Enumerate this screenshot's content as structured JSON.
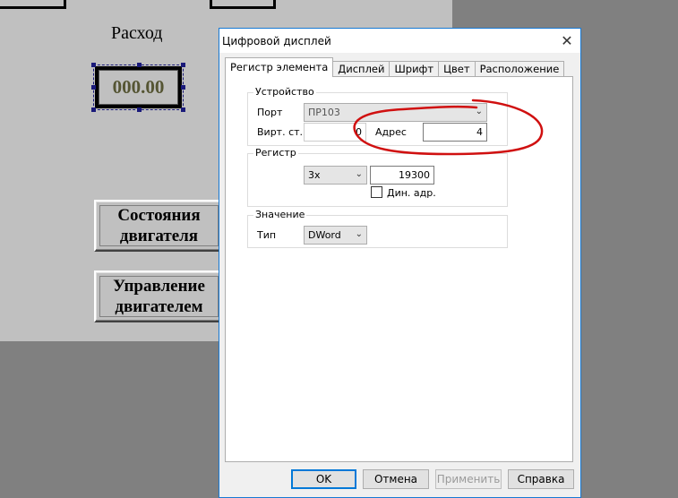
{
  "background": {
    "caption": "Расход",
    "display_value": "000.00",
    "buttons": [
      {
        "line1": "Состояния",
        "line2": "двигателя"
      },
      {
        "line1": "Управление",
        "line2": "двигателем"
      }
    ]
  },
  "dialog": {
    "title": "Цифровой дисплей",
    "close_glyph": "✕",
    "tabs": [
      "Регистр элемента",
      "Дисплей",
      "Шрифт",
      "Цвет",
      "Расположение"
    ],
    "active_tab": "Регистр элемента",
    "device_group": {
      "title": "Устройство",
      "port_label": "Порт",
      "port_value": "ПР103",
      "virt_label": "Вирт. ст.",
      "virt_value": "0",
      "address_label": "Адрес",
      "address_value": "4"
    },
    "register_group": {
      "title": "Регистр",
      "type_value": "3x",
      "register_value": "19300",
      "dyn_addr_label": "Дин. адр.",
      "dyn_addr_checked": false
    },
    "value_group": {
      "title": "Значение",
      "type_label": "Тип",
      "type_value": "DWord"
    },
    "buttons": {
      "ok": "OK",
      "cancel": "Отмена",
      "apply": "Применить",
      "help": "Справка"
    },
    "annotation_color": "#d01010"
  }
}
